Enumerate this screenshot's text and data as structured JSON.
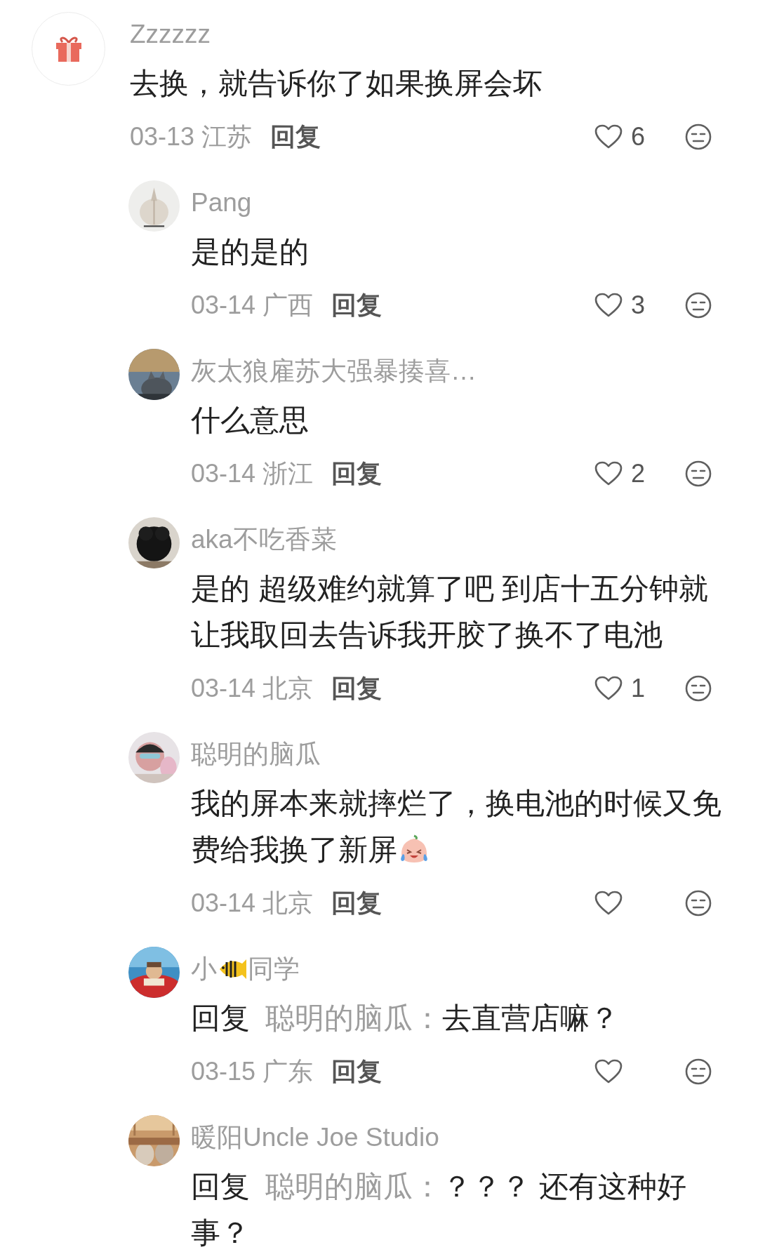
{
  "comments": [
    {
      "kind": "top",
      "avatar": {
        "kind": "gift"
      },
      "name": [
        {
          "kind": "text",
          "text": "Zzzzzz"
        }
      ],
      "body": [
        {
          "kind": "text",
          "text": "去换，就告诉你了如果换屏会坏"
        }
      ],
      "date": "03-13",
      "location": "江苏",
      "reply_button": "回复",
      "likes": "6"
    },
    {
      "kind": "reply",
      "avatar": {
        "kind": "picture"
      },
      "name": [
        {
          "kind": "text",
          "text": "Pang"
        }
      ],
      "body": [
        {
          "kind": "text",
          "text": "是的是的"
        }
      ],
      "date": "03-14",
      "location": "广西",
      "reply_button": "回复",
      "likes": "3"
    },
    {
      "kind": "reply",
      "avatar": {
        "kind": "picture"
      },
      "name": [
        {
          "kind": "text",
          "text": "灰太狼雇苏大强暴揍喜…"
        }
      ],
      "body": [
        {
          "kind": "text",
          "text": "什么意思"
        }
      ],
      "date": "03-14",
      "location": "浙江",
      "reply_button": "回复",
      "likes": "2"
    },
    {
      "kind": "reply",
      "avatar": {
        "kind": "picture"
      },
      "name": [
        {
          "kind": "text",
          "text": "aka不吃香菜"
        }
      ],
      "body": [
        {
          "kind": "text",
          "text": "是的 超级难约就算了吧 到店十五分钟就让我取回去告诉我开胶了换不了电池"
        }
      ],
      "date": "03-14",
      "location": "北京",
      "reply_button": "回复",
      "likes": "1"
    },
    {
      "kind": "reply",
      "avatar": {
        "kind": "picture"
      },
      "name": [
        {
          "kind": "text",
          "text": "聪明的脑瓜"
        }
      ],
      "body": [
        {
          "kind": "text",
          "text": "我的屏本来就摔烂了，换电池的时候又免费给我换了新屏"
        },
        {
          "kind": "laughing"
        }
      ],
      "date": "03-14",
      "location": "北京",
      "reply_button": "回复"
    },
    {
      "kind": "reply",
      "avatar": {
        "kind": "picture"
      },
      "name": [
        {
          "kind": "text",
          "text": "小"
        },
        {
          "kind": "fish"
        },
        {
          "kind": "text",
          "text": "同学"
        }
      ],
      "body": [
        {
          "kind": "prefix",
          "text": "回复"
        },
        {
          "kind": "mention",
          "text": "聪明的脑瓜："
        },
        {
          "kind": "text",
          "text": "去直营店嘛？"
        }
      ],
      "date": "03-15",
      "location": "广东",
      "reply_button": "回复"
    },
    {
      "kind": "reply",
      "avatar": {
        "kind": "picture"
      },
      "name": [
        {
          "kind": "text",
          "text": "暖阳Uncle Joe Studio"
        }
      ],
      "body": [
        {
          "kind": "prefix",
          "text": "回复"
        },
        {
          "kind": "mention",
          "text": "聪明的脑瓜："
        },
        {
          "kind": "text",
          "text": "？？？ 还有这种好事？"
        }
      ]
    }
  ]
}
